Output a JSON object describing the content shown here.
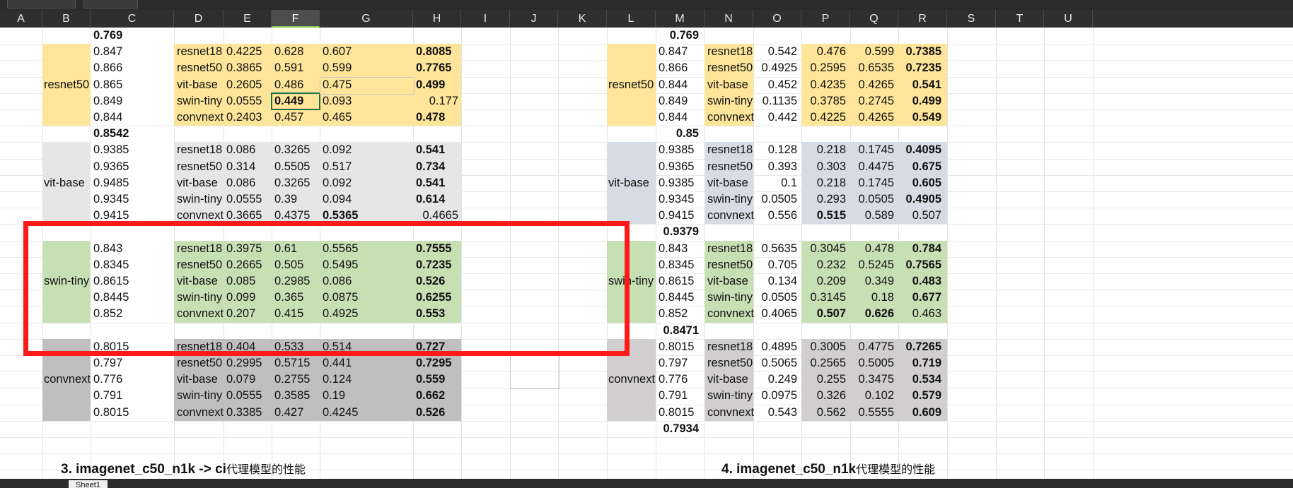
{
  "columns": [
    "A",
    "B",
    "C",
    "D",
    "E",
    "F",
    "G",
    "H",
    "I",
    "J",
    "K",
    "L",
    "M",
    "N",
    "O",
    "P",
    "Q",
    "R",
    "S",
    "T",
    "U"
  ],
  "selected_column": "F",
  "left_table": {
    "blocks": [
      {
        "group": "resnet50",
        "header": "0.769",
        "rows": [
          {
            "acc": "0.847",
            "model": "resnet18",
            "e": "0.4225",
            "f": "0.628",
            "g": "0.607",
            "h": "0.8085"
          },
          {
            "acc": "0.866",
            "model": "resnet50",
            "e": "0.3865",
            "f": "0.591",
            "g": "0.599",
            "h": "0.7765"
          },
          {
            "acc": "0.865",
            "model": "vit-base",
            "e": "0.2605",
            "f": "0.486",
            "g": "0.475",
            "h": "0.499"
          },
          {
            "acc": "0.849",
            "model": "swin-tiny",
            "e": "0.0555",
            "f": "0.449",
            "g": "0.093",
            "h": "0.177"
          },
          {
            "acc": "0.844",
            "model": "convnext",
            "e": "0.2403",
            "f": "0.457",
            "g": "0.465",
            "h": "0.478"
          }
        ]
      },
      {
        "group": "vit-base",
        "header": "0.8542",
        "rows": [
          {
            "acc": "0.9385",
            "model": "resnet18",
            "e": "0.086",
            "f": "0.3265",
            "g": "0.092",
            "h": "0.541"
          },
          {
            "acc": "0.9365",
            "model": "resnet50",
            "e": "0.314",
            "f": "0.5505",
            "g": "0.517",
            "h": "0.734"
          },
          {
            "acc": "0.9485",
            "model": "vit-base",
            "e": "0.086",
            "f": "0.3265",
            "g": "0.092",
            "h": "0.541"
          },
          {
            "acc": "0.9345",
            "model": "swin-tiny",
            "e": "0.0555",
            "f": "0.39",
            "g": "0.094",
            "h": "0.614"
          },
          {
            "acc": "0.9415",
            "model": "convnext",
            "e": "0.3665",
            "f": "0.4375",
            "g": "0.5365",
            "h": "0.4665"
          }
        ]
      },
      {
        "group": "swin-tiny",
        "header": "",
        "rows": [
          {
            "acc": "0.843",
            "model": "resnet18",
            "e": "0.3975",
            "f": "0.61",
            "g": "0.5565",
            "h": "0.7555"
          },
          {
            "acc": "0.8345",
            "model": "resnet50",
            "e": "0.2665",
            "f": "0.505",
            "g": "0.5495",
            "h": "0.7235"
          },
          {
            "acc": "0.8615",
            "model": "vit-base",
            "e": "0.085",
            "f": "0.2985",
            "g": "0.086",
            "h": "0.526"
          },
          {
            "acc": "0.8445",
            "model": "swin-tiny",
            "e": "0.099",
            "f": "0.365",
            "g": "0.0875",
            "h": "0.6255"
          },
          {
            "acc": "0.852",
            "model": "convnext",
            "e": "0.207",
            "f": "0.415",
            "g": "0.4925",
            "h": "0.553"
          }
        ]
      },
      {
        "group": "convnext",
        "header": "",
        "rows": [
          {
            "acc": "0.8015",
            "model": "resnet18",
            "e": "0.404",
            "f": "0.533",
            "g": "0.514",
            "h": "0.727"
          },
          {
            "acc": "0.797",
            "model": "resnet50",
            "e": "0.2995",
            "f": "0.5715",
            "g": "0.441",
            "h": "0.7295"
          },
          {
            "acc": "0.776",
            "model": "vit-base",
            "e": "0.079",
            "f": "0.2755",
            "g": "0.124",
            "h": "0.559"
          },
          {
            "acc": "0.791",
            "model": "swin-tiny",
            "e": "0.0555",
            "f": "0.3585",
            "g": "0.19",
            "h": "0.662"
          },
          {
            "acc": "0.8015",
            "model": "convnext",
            "e": "0.3385",
            "f": "0.427",
            "g": "0.4245",
            "h": "0.526"
          }
        ]
      }
    ]
  },
  "right_table": {
    "blocks": [
      {
        "group": "resnet50",
        "header": "0.769",
        "rows": [
          {
            "acc": "0.847",
            "model": "resnet18",
            "o": "0.542",
            "p": "0.476",
            "q": "0.599",
            "r": "0.7385"
          },
          {
            "acc": "0.866",
            "model": "resnet50",
            "o": "0.4925",
            "p": "0.2595",
            "q": "0.6535",
            "r": "0.7235"
          },
          {
            "acc": "0.844",
            "model": "vit-base",
            "o": "0.452",
            "p": "0.4235",
            "q": "0.4265",
            "r": "0.541"
          },
          {
            "acc": "0.849",
            "model": "swin-tiny",
            "o": "0.1135",
            "p": "0.3785",
            "q": "0.2745",
            "r": "0.499"
          },
          {
            "acc": "0.844",
            "model": "convnext",
            "o": "0.442",
            "p": "0.4225",
            "q": "0.4265",
            "r": "0.549"
          }
        ]
      },
      {
        "group": "vit-base",
        "header": "0.85",
        "rows": [
          {
            "acc": "0.9385",
            "model": "resnet18",
            "o": "0.128",
            "p": "0.218",
            "q": "0.1745",
            "r": "0.4095"
          },
          {
            "acc": "0.9365",
            "model": "resnet50",
            "o": "0.393",
            "p": "0.303",
            "q": "0.4475",
            "r": "0.675"
          },
          {
            "acc": "0.9385",
            "model": "vit-base",
            "o": "0.1",
            "p": "0.218",
            "q": "0.1745",
            "r": "0.605"
          },
          {
            "acc": "0.9345",
            "model": "swin-tiny",
            "o": "0.0505",
            "p": "0.293",
            "q": "0.0505",
            "r": "0.4905"
          },
          {
            "acc": "0.9415",
            "model": "convnext",
            "o": "0.556",
            "p": "0.515",
            "q": "0.589",
            "r": "0.507"
          }
        ]
      },
      {
        "group": "swin-tiny",
        "header": "0.9379",
        "rows": [
          {
            "acc": "0.843",
            "model": "resnet18",
            "o": "0.5635",
            "p": "0.3045",
            "q": "0.478",
            "r": "0.784"
          },
          {
            "acc": "0.8345",
            "model": "resnet50",
            "o": "0.705",
            "p": "0.232",
            "q": "0.5245",
            "r": "0.7565"
          },
          {
            "acc": "0.8615",
            "model": "vit-base",
            "o": "0.134",
            "p": "0.209",
            "q": "0.349",
            "r": "0.483"
          },
          {
            "acc": "0.8445",
            "model": "swin-tiny",
            "o": "0.0505",
            "p": "0.3145",
            "q": "0.18",
            "r": "0.677"
          },
          {
            "acc": "0.852",
            "model": "convnext",
            "o": "0.4065",
            "p": "0.507",
            "q": "0.626",
            "r": "0.463"
          }
        ]
      },
      {
        "group": "convnext",
        "header": "0.8471",
        "rows": [
          {
            "acc": "0.8015",
            "model": "resnet18",
            "o": "0.4895",
            "p": "0.3005",
            "q": "0.4775",
            "r": "0.7265"
          },
          {
            "acc": "0.797",
            "model": "resnet50",
            "o": "0.5065",
            "p": "0.2565",
            "q": "0.5005",
            "r": "0.719"
          },
          {
            "acc": "0.776",
            "model": "vit-base",
            "o": "0.249",
            "p": "0.255",
            "q": "0.3475",
            "r": "0.534"
          },
          {
            "acc": "0.791",
            "model": "swin-tiny",
            "o": "0.0975",
            "p": "0.326",
            "q": "0.102",
            "r": "0.579"
          },
          {
            "acc": "0.8015",
            "model": "convnext",
            "o": "0.543",
            "p": "0.562",
            "q": "0.5555",
            "r": "0.609"
          }
        ]
      }
    ],
    "footer": "0.7934"
  },
  "notes": {
    "left_bold": "3. imagenet_c50_n1k -> ci",
    "left_rest": "代理模型的性能",
    "right_bold": "4. imagenet_c50_n1k",
    "right_rest": "代理模型的性能"
  },
  "sheet_tab": "Sheet1",
  "colors": {
    "resnet50": "#ffe599",
    "vit_left": "#e7e6e6",
    "vit_right": "#d6dce4",
    "swin": "#c6e0b4",
    "convnext_left": "#bfbfbf",
    "convnext_right": "#d0cece",
    "highlight_box": "#ff1a1a"
  }
}
